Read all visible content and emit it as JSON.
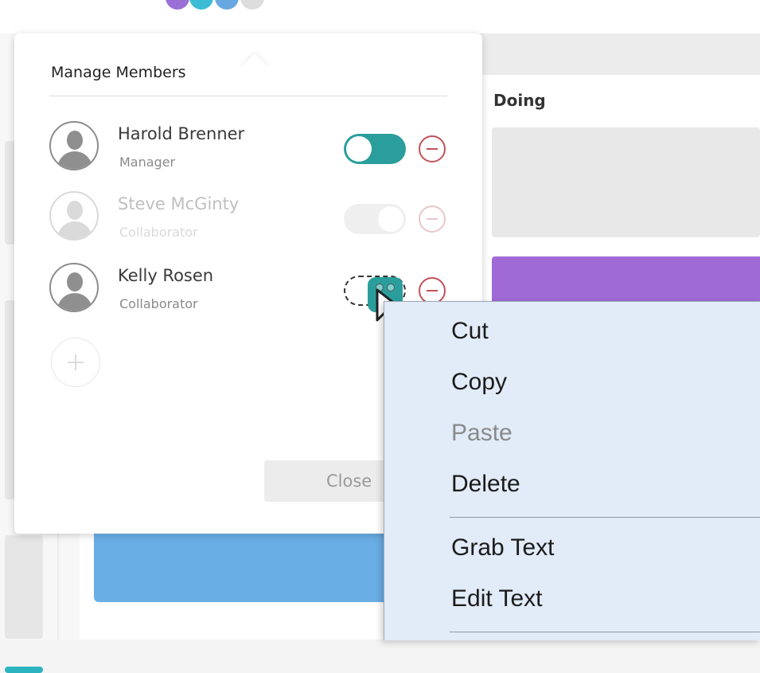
{
  "board": {
    "column_title": "Doing"
  },
  "colors": {
    "teal": "#2a9e9c",
    "purple_card": "#a06ad6",
    "blue_card": "#6aaee6",
    "remove_red": "#c1525a",
    "context_menu_bg": "#e2ebf8"
  },
  "dialog": {
    "title": "Manage Members",
    "members": [
      {
        "name": "Harold Brenner",
        "role": "Manager",
        "toggle_state": "on",
        "avatar_icon": "user-silhouette-icon"
      },
      {
        "name": "Steve McGinty",
        "role": "Collaborator",
        "toggle_state": "off",
        "avatar_icon": "user-silhouette-icon"
      },
      {
        "name": "Kelly Rosen",
        "role": "Collaborator",
        "toggle_state": "being-dragged",
        "avatar_icon": "user-silhouette-icon"
      }
    ],
    "add_member_icon": "plus-icon",
    "remove_icon": "minus-circle-icon",
    "close_label": "Close"
  },
  "context_menu": {
    "items": [
      {
        "label": "Cut",
        "enabled": true
      },
      {
        "label": "Copy",
        "enabled": true
      },
      {
        "label": "Paste",
        "enabled": false
      },
      {
        "label": "Delete",
        "enabled": true
      },
      {
        "label": "Grab Text",
        "enabled": true
      },
      {
        "label": "Edit Text",
        "enabled": true
      }
    ]
  }
}
